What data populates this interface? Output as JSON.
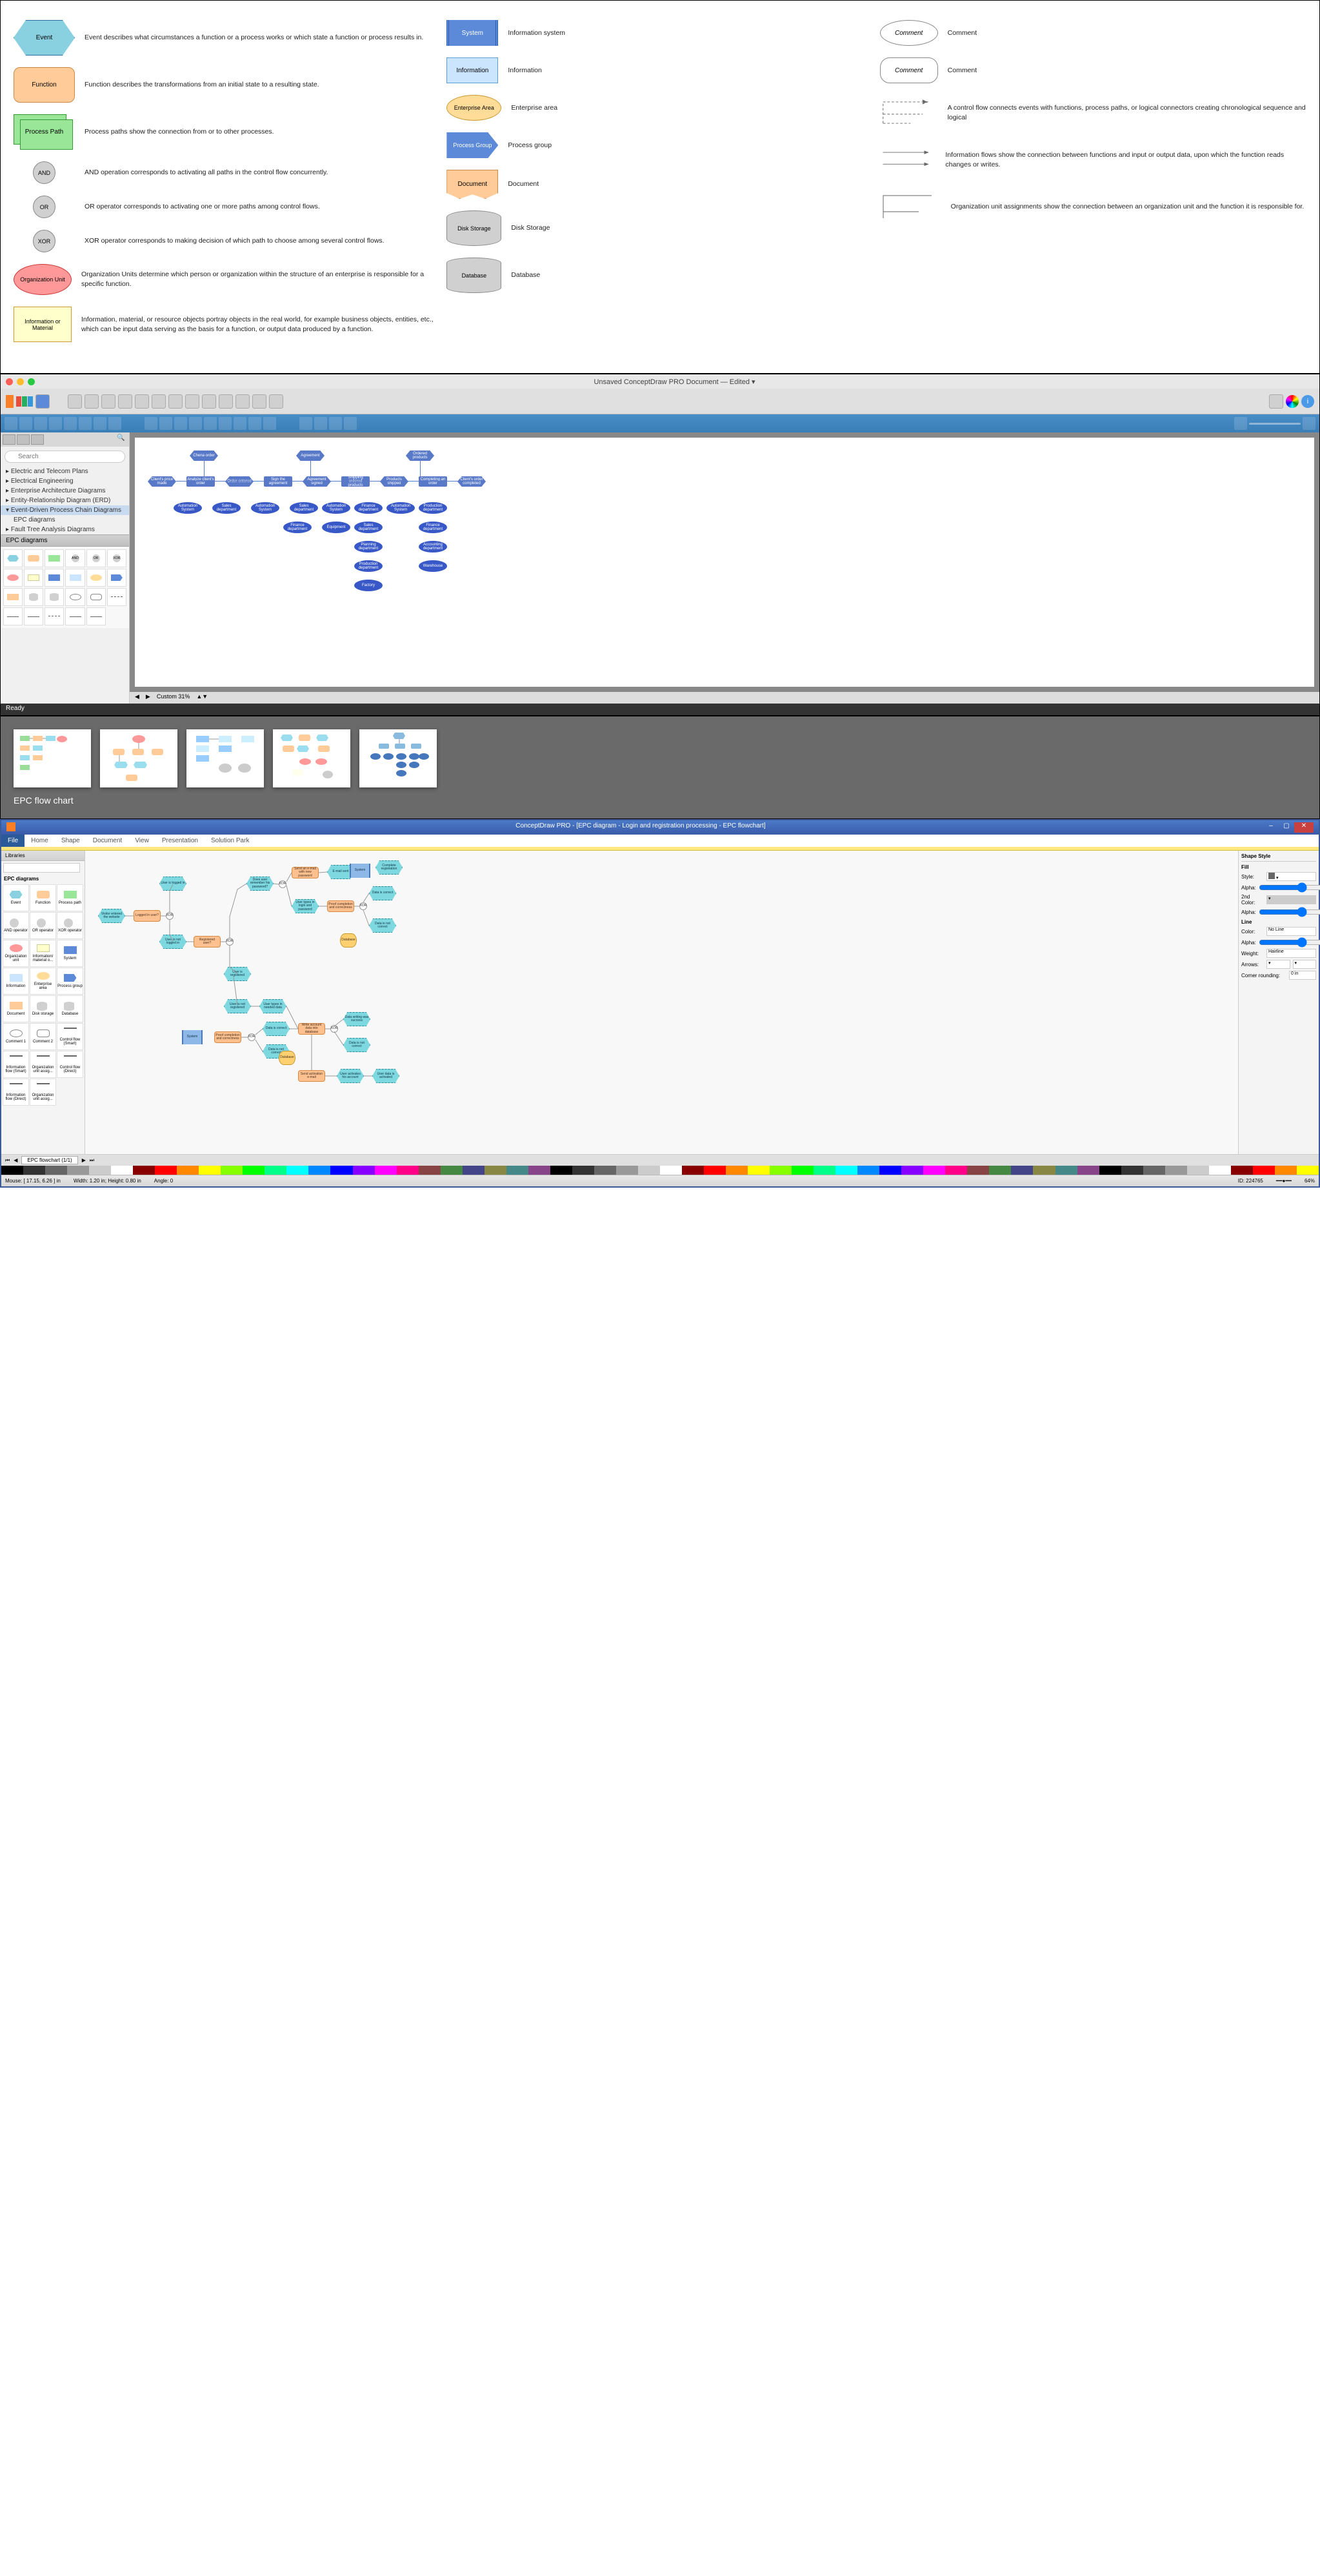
{
  "legend": {
    "col1": [
      {
        "shape": "event",
        "label": "Event",
        "desc": "Event describes what circumstances a function or a process works or which state a function or process results in."
      },
      {
        "shape": "function",
        "label": "Function",
        "desc": "Function describes the transformations from an initial state to a resulting state."
      },
      {
        "shape": "processpath",
        "label": "Process Path",
        "desc": "Process paths show the connection from or to other processes."
      },
      {
        "shape": "op",
        "label": "AND",
        "desc": "AND operation corresponds to activating all paths in the control flow concurrently."
      },
      {
        "shape": "op",
        "label": "OR",
        "desc": "OR operator corresponds to activating one or more paths among control flows."
      },
      {
        "shape": "op",
        "label": "XOR",
        "desc": "XOR operator corresponds to making decision of which path to choose among several control flows."
      },
      {
        "shape": "orgunit",
        "label": "Organization Unit",
        "desc": "Organization Units determine which person or organization within the structure of an enterprise is responsible for a specific function."
      },
      {
        "shape": "infomat",
        "label": "Information or Material",
        "desc": "Information, material, or resource objects portray objects in the real world, for example business objects, entities, etc., which can be input data serving as the basis for a function, or output data produced by a function."
      }
    ],
    "col2": [
      {
        "shape": "system",
        "label": "System",
        "desc": "Information system"
      },
      {
        "shape": "information",
        "label": "Information",
        "desc": "Information"
      },
      {
        "shape": "entarea",
        "label": "Enterprise Area",
        "desc": "Enterprise area"
      },
      {
        "shape": "procgroup",
        "label": "Process Group",
        "desc": "Process group"
      },
      {
        "shape": "document",
        "label": "Document",
        "desc": "Document"
      },
      {
        "shape": "disk",
        "label": "Disk Storage",
        "desc": "Disk Storage"
      },
      {
        "shape": "database",
        "label": "Database",
        "desc": "Database"
      }
    ],
    "col3": [
      {
        "shape": "comment",
        "label": "Comment",
        "desc": "Comment"
      },
      {
        "shape": "comment2",
        "label": "Comment",
        "desc": "Comment"
      },
      {
        "shape": "flow-dashed",
        "label": "",
        "desc": "A control flow connects events with functions, process paths, or logical connectors creating chronological sequence and logical"
      },
      {
        "shape": "flow-solid",
        "label": "",
        "desc": "Information flows show the connection between functions and input or output data, upon which the function reads changes or writes."
      },
      {
        "shape": "flow-org",
        "label": "",
        "desc": "Organization unit assignments show the connection between an organization unit and the function it is responsible for."
      }
    ]
  },
  "macApp": {
    "title": "Unsaved ConceptDraw PRO Document — Edited ▾",
    "searchPlaceholder": "Search",
    "treeItems": [
      "Electric and Telecom Plans",
      "Electrical Engineering",
      "Enterprise Architecture Diagrams",
      "Entity-Relationship Diagram (ERD)",
      "Event-Driven Process Chain Diagrams",
      "EPC diagrams",
      "Fault Tree Analysis Diagrams"
    ],
    "treeSelected": 4,
    "paletteTitle": "EPC diagrams",
    "zoom": "Custom 31%",
    "status": "Ready",
    "nodes": {
      "top": [
        "Chena order",
        "Agreement",
        "Ordered products"
      ],
      "row": [
        "Client's price made",
        "Analyze client's order",
        "Order entered",
        "Sign the agreement",
        "Agreement signed",
        "Shipping ordered products",
        "Products shipped",
        "Completing an order",
        "Client's order completed"
      ],
      "orgs": [
        "Automation System",
        "Sales department",
        "Automation System",
        "Sales department",
        "Automation System",
        "Finance department",
        "Automation System",
        "Production department",
        "Finance department",
        "Equipment",
        "Sales department",
        "Finance department",
        "Planning department",
        "Accounting department",
        "Production department",
        "Warehouse",
        "Factory"
      ]
    }
  },
  "gallery": {
    "caption": "EPC flow chart"
  },
  "winApp": {
    "title": "ConceptDraw PRO - [EPC diagram - Login and registration processing - EPC flowchart]",
    "tabs": [
      "File",
      "Home",
      "Shape",
      "Document",
      "View",
      "Presentation",
      "Solution Park"
    ],
    "leftTitle": "Libraries",
    "libSection": "EPC diagrams",
    "libItems": [
      "Event",
      "Function",
      "Process path",
      "AND operator",
      "OR operator",
      "XOR operator",
      "Organization unit",
      "Information/ material o...",
      "System",
      "Information",
      "Enterprise area",
      "Process group",
      "Document",
      "Disk storage",
      "Database",
      "Comment 1",
      "Comment 2",
      "Control flow (Smart)",
      "Information flow (Smart)",
      "Organization unit assig...",
      "Control flow (Direct)",
      "Information flow (Direct)",
      "Organization unit assig..."
    ],
    "rightTitle": "Shape Style",
    "props": {
      "fillLabel": "Fill",
      "styleLabel": "Style:",
      "style": "",
      "alpha1Label": "Alpha:",
      "alpha1": "0",
      "color2Label": "2nd Color:",
      "color2": "",
      "alpha2Label": "Alpha:",
      "alpha2": "0",
      "lineLabel": "Line",
      "colorLabel": "Color:",
      "color": "No Line",
      "alpha3Label": "Alpha:",
      "alpha3": "0",
      "weightLabel": "Weight:",
      "weight": "Hairline",
      "arrowsLabel": "Arrows:",
      "cornerLabel": "Corner rounding:",
      "corner": "0 in"
    },
    "tabName": "EPC flowchart (1/1)",
    "statusbar": {
      "mouse": "Mouse: [ 17.15, 6.26 ] in",
      "width": "Width: 1.20 in; Height: 0.80 in",
      "angle": "Angle: 0",
      "id": "ID: 224765",
      "zoom": "64%"
    },
    "nodes": {
      "events": [
        "Visitor entered the website",
        "User is logged in",
        "User is not logged in",
        "Does user remember his password?",
        "User is registered",
        "User is not registered",
        "Data is correct",
        "Data is not correct",
        "Data is correct",
        "Data is not correct",
        "User types in login and password",
        "User types in needed data",
        "Data writing was success",
        "Data is not correct",
        "Data is correct",
        "Complete registration",
        "User activates his account",
        "User data is activated"
      ],
      "funcs": [
        "Logged in user?",
        "Registered user?",
        "Send an e-mail with new password",
        "Proof completion and correctness",
        "Proof completion and correctness",
        "Write account data into database",
        "Send activation e-mail",
        "E-mail sent"
      ],
      "systems": [
        "System",
        "System"
      ],
      "dbs": [
        "Database",
        "Database"
      ]
    }
  }
}
